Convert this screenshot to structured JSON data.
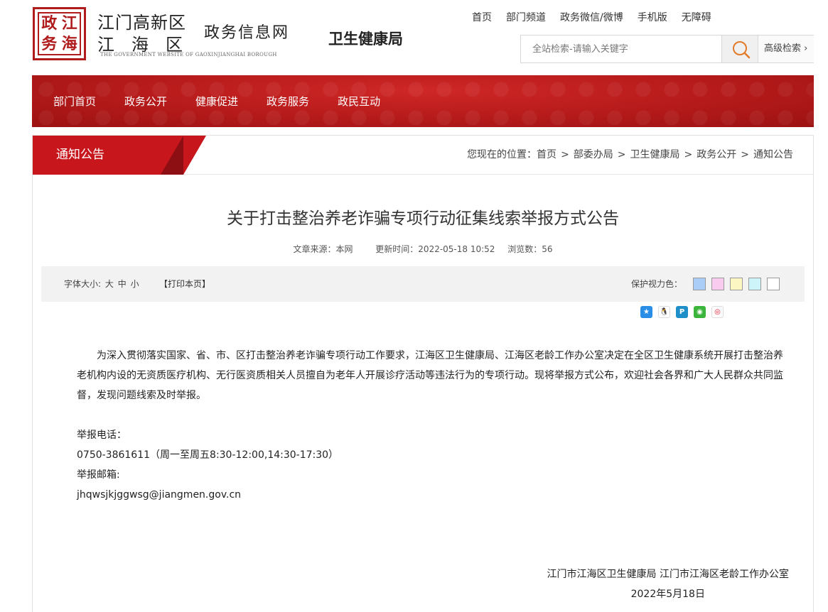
{
  "header": {
    "seal_chars": [
      "政",
      "江",
      "务",
      "海"
    ],
    "logo_line1": "江门高新区",
    "logo_line2": "江海区",
    "logo_line3": "政务信息网",
    "logo_en": "THE GOVERNMENT WEBSITE OF GAOXINJIANGHAI BOROUGH",
    "dept_name": "卫生健康局",
    "top_links": [
      "首页",
      "部门频道",
      "政务微信/微博",
      "手机版",
      "无障碍"
    ],
    "search_placeholder": "全站检索-请输入关键字",
    "search_icon": "search-icon",
    "advanced_search": "高级检索 ›"
  },
  "nav": {
    "items": [
      "部门首页",
      "政务公开",
      "健康促进",
      "政务服务",
      "政民互动"
    ],
    "accent_color": "#c8161d"
  },
  "section": {
    "title": "通知公告",
    "breadcrumb": [
      "您现在的位置：首页",
      ">",
      "部委办局",
      ">",
      "卫生健康局",
      ">",
      "政务公开",
      ">",
      "通知公告"
    ]
  },
  "article": {
    "title": "关于打击整治养老诈骗专项行动征集线索举报方式公告",
    "source": "文章来源：本网",
    "updated": "更新时间：2022-05-18 10:52",
    "views": "浏览数：56",
    "font_size_label": "字体大小:",
    "font_sizes": [
      "大",
      "中",
      "小"
    ],
    "print_label": "【打印本页】",
    "eye_protect_label": "保护视力色：",
    "eye_colors": [
      "#a9cdf7",
      "#f9ccef",
      "#fcf6c2",
      "#cdf4f9",
      "#ffffff"
    ],
    "share_icons": [
      "qzone-icon",
      "qq-icon",
      "tencent-weibo-icon",
      "wechat-icon",
      "sina-weibo-icon"
    ],
    "body": "为深入贯彻落实国家、省、市、区打击整治养老诈骗专项行动工作要求，江海区卫生健康局、江海区老龄工作办公室决定在全区卫生健康系统开展打击整治养老机构内设的无资质医疗机构、无行医资质相关人员擅自为老年人开展诊疗活动等违法行为的专项行动。现将举报方式公布，欢迎社会各界和广大人民群众共同监督，发现问题线索及时举报。",
    "contact_phone_label": "举报电话：",
    "contact_phone": "0750-3861611（周一至周五8:30-12:00,14:30-17:30）",
    "contact_email_label": "举报邮箱:",
    "contact_email": "jhqwsjkjggwsg@jiangmen.gov.cn",
    "signer": "江门市江海区卫生健康局 江门市江海区老龄工作办公室",
    "date": "2022年5月18日"
  }
}
